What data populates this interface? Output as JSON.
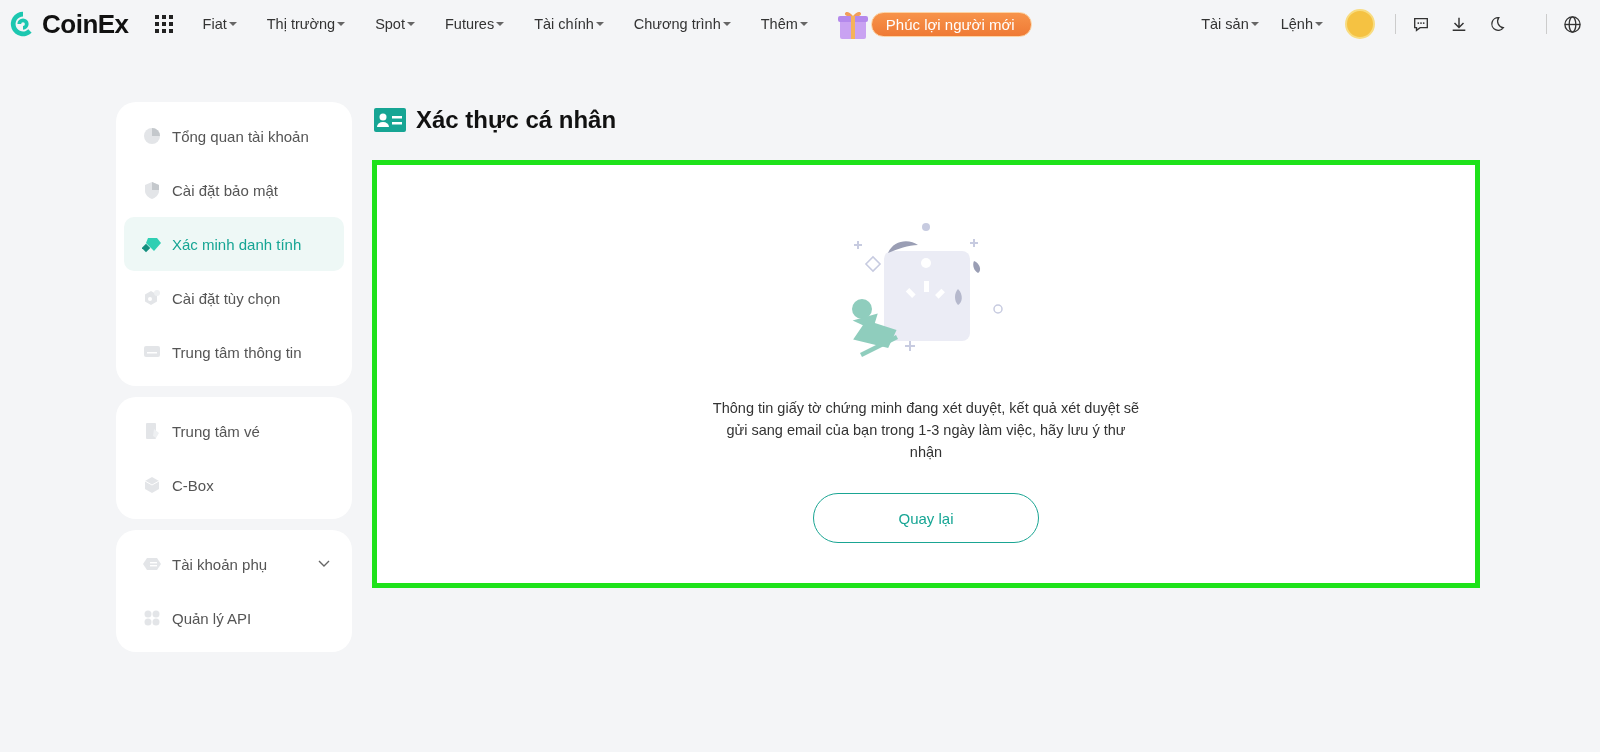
{
  "header": {
    "logo": "CoinEx",
    "nav": [
      {
        "label": "Fiat"
      },
      {
        "label": "Thị trường"
      },
      {
        "label": "Spot"
      },
      {
        "label": "Futures"
      },
      {
        "label": "Tài chính"
      },
      {
        "label": "Chương trình"
      },
      {
        "label": "Thêm"
      }
    ],
    "promo": "Phúc lợi người mới",
    "right_nav": [
      {
        "label": "Tài sản"
      },
      {
        "label": "Lệnh"
      }
    ]
  },
  "sidebar": {
    "groups": [
      {
        "items": [
          {
            "label": "Tổng quan tài khoản",
            "selected": false,
            "kind": "link"
          },
          {
            "label": "Cài đặt bảo mật",
            "selected": false,
            "kind": "link"
          },
          {
            "label": "Xác minh danh tính",
            "selected": true,
            "kind": "link"
          },
          {
            "label": "Cài đặt tùy chọn",
            "selected": false,
            "kind": "link"
          },
          {
            "label": "Trung tâm thông tin",
            "selected": false,
            "kind": "link"
          }
        ]
      },
      {
        "items": [
          {
            "label": "Trung tâm vé",
            "selected": false,
            "kind": "link"
          },
          {
            "label": "C-Box",
            "selected": false,
            "kind": "link"
          }
        ]
      },
      {
        "items": [
          {
            "label": "Tài khoản phụ",
            "selected": false,
            "kind": "group"
          },
          {
            "label": "Quản lý API",
            "selected": false,
            "kind": "link"
          }
        ]
      }
    ]
  },
  "main": {
    "title": "Xác thực cá nhân",
    "message": "Thông tin giấy tờ chứng minh đang xét duyệt, kết quả xét duyệt sẽ gửi sang email của bạn trong 1-3 ngày làm việc, hãy lưu ý thư nhận",
    "button": "Quay lại"
  }
}
